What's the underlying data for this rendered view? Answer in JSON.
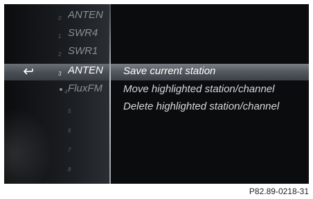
{
  "presets": [
    {
      "number": "0",
      "name": "ANTEN"
    },
    {
      "number": "1",
      "name": "SWR4"
    },
    {
      "number": "2",
      "name": "SWR1"
    },
    {
      "number": "3",
      "name": "ANTEN",
      "active": true
    },
    {
      "number": "4",
      "name": "FluxFM",
      "dot": true
    },
    {
      "number": "5",
      "name": ""
    },
    {
      "number": "6",
      "name": ""
    },
    {
      "number": "7",
      "name": ""
    },
    {
      "number": "8",
      "name": ""
    }
  ],
  "menu": {
    "save_current_station": "Save current station",
    "move_highlighted": "Move highlighted station/channel",
    "delete_highlighted": "Delete highlighted station/channel"
  },
  "caption": "P82.89-0218-31",
  "colors": {
    "background": "#0b0c0d",
    "highlight": "#5a5f66",
    "text": "#d6d9dc",
    "preset_text": "#8a9096"
  },
  "icons": {
    "back": "back-arrow-icon"
  }
}
